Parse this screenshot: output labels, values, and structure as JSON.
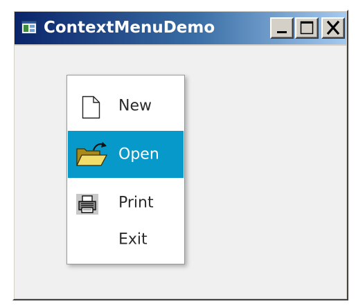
{
  "window": {
    "title": "ContextMenuDemo",
    "buttons": {
      "minimize": "_",
      "maximize": "□",
      "close": "X"
    }
  },
  "context_menu": {
    "items": [
      {
        "label": "New",
        "icon": "new-file-icon",
        "selected": false
      },
      {
        "label": "Open",
        "icon": "open-folder-icon",
        "selected": true
      },
      {
        "label": "Print",
        "icon": "printer-icon",
        "selected": false
      },
      {
        "label": "Exit",
        "icon": null,
        "selected": false
      }
    ]
  },
  "colors": {
    "title_bar_start": "#0a246a",
    "title_bar_end": "#a6caf0",
    "menu_highlight": "#0699c9",
    "client_background": "#f0f0f0"
  }
}
